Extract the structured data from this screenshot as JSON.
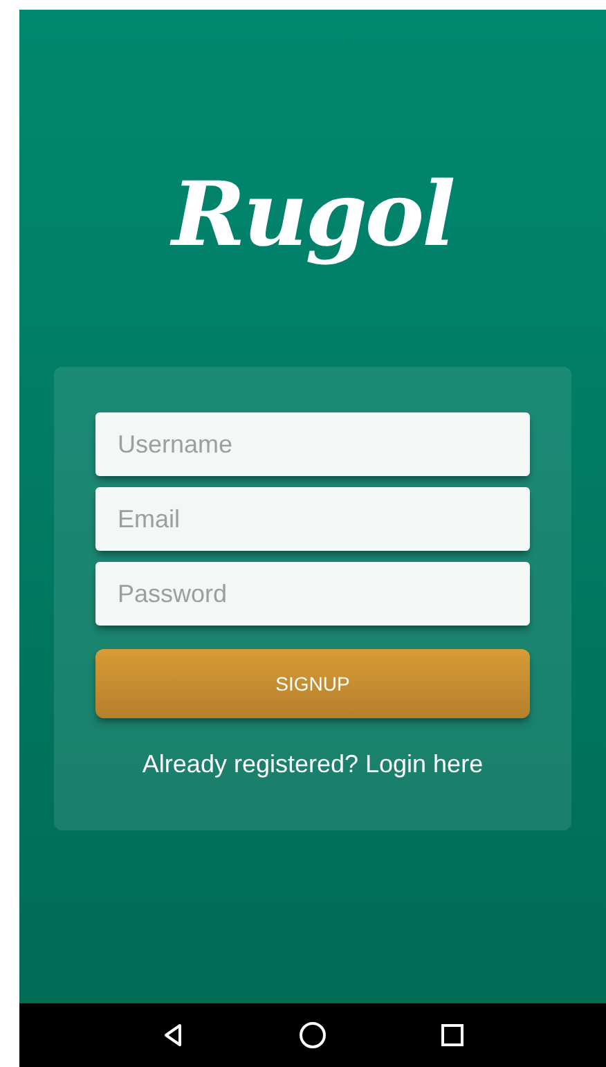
{
  "logo": {
    "text": "Rugol"
  },
  "form": {
    "fields": [
      {
        "placeholder": "Username"
      },
      {
        "placeholder": "Email"
      },
      {
        "placeholder": "Password"
      }
    ],
    "submit_button": "SIGNUP",
    "login_link": "Already registered? Login here"
  },
  "navigation_bar": {
    "buttons": [
      {
        "kind": "back"
      },
      {
        "kind": "home"
      },
      {
        "kind": "recents"
      }
    ]
  }
}
